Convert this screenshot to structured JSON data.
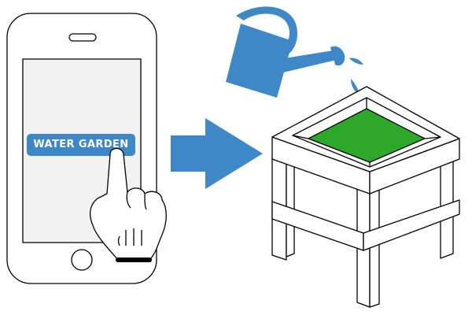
{
  "colors": {
    "accent": "#3f88c8",
    "button": "#3f88c8",
    "screen": "#f2f2f2",
    "soil": "#2ea82b"
  },
  "icons": [
    "smartphone-icon",
    "tapping-hand-icon",
    "arrow-right-icon",
    "watering-can-icon",
    "water-droplet-icon",
    "planter-box-icon"
  ],
  "phone": {
    "button_label": "WATER GARDEN"
  }
}
